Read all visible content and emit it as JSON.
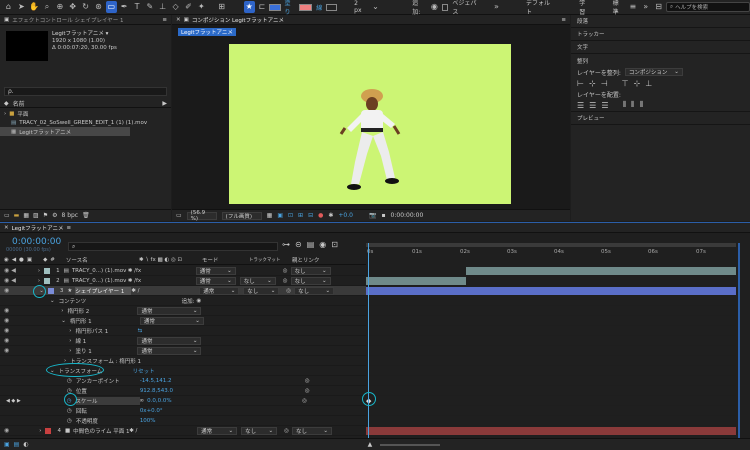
{
  "toolbar": {
    "fill_label": "塗り",
    "stroke_label": "線",
    "stroke_width": "2 px",
    "add_label": "追加:",
    "bezier_label": "ベジェパス",
    "workspaces": [
      "デフォルト",
      "学習",
      "標準"
    ],
    "search_placeholder": "ヘルプを検索",
    "fill_color": "#3a6fd8",
    "stroke_color": "#f08080"
  },
  "effect_controls": {
    "tab_label": "エフェクトコントロール シェイプレイヤー 1"
  },
  "project": {
    "comp_name": "Legitフラットアニメ ▾",
    "comp_size": "1920 x 1080 (1.00)",
    "comp_duration": "Δ 0:00:07:20, 30.00 fps",
    "search_icon_glyph": "ρ.",
    "column_name": "名前",
    "items": [
      {
        "name": "平面",
        "type": "folder"
      },
      {
        "name": "TRACY_02_SoSwell_GREEN_EDIT_1 (1) (1).mov",
        "type": "footage"
      },
      {
        "name": "Legitフラットアニメ",
        "type": "comp"
      }
    ],
    "bpc": "8 bpc"
  },
  "composition": {
    "tab_label": "コンポジション Legitフラットアニメ",
    "breadcrumb": "Legitフラットアニメ",
    "zoom": "(56.9 %)",
    "resolution": "(フル画質)",
    "exposure": "+0.0",
    "timecode": "0:00:00:00",
    "bg_color": "#ccf574"
  },
  "right_panel": {
    "items": [
      "段落",
      "トラッカー",
      "文字",
      "整列",
      "プレビュー"
    ],
    "align_to_label": "レイヤーを整列:",
    "align_to_value": "コンポジション",
    "distribute_label": "レイヤーを配置:"
  },
  "timeline": {
    "tab_label": "Legitフラットアニメ",
    "timecode": "0:00:00:00",
    "timecode_sub": "00000 (30.00 fps)",
    "col_source": "ソース名",
    "col_mode": "モード",
    "col_trkmat": "トラックマット",
    "col_parent": "親とリンク",
    "ruler": [
      "0s",
      "01s",
      "02s",
      "03s",
      "04s",
      "05s",
      "06s",
      "07s"
    ],
    "layers": [
      {
        "num": "1",
        "name": "TRACY_0...) (1).mov",
        "mode": "通常",
        "trkmat": "",
        "parent": "なし",
        "color": "#9fbfbf"
      },
      {
        "num": "2",
        "name": "TRACY_0...) (1).mov",
        "mode": "通常",
        "trkmat": "なし",
        "parent": "なし",
        "color": "#9fbfbf"
      },
      {
        "num": "3",
        "name": "シェイプレイヤー 1",
        "mode": "通常",
        "trkmat": "なし",
        "parent": "なし",
        "color": "#7a8cd8"
      },
      {
        "num": "4",
        "name": "中間色のライム 平面 1",
        "mode": "通常",
        "trkmat": "なし",
        "parent": "なし",
        "color": "#c84040"
      }
    ],
    "props": {
      "contents": "コンテンツ",
      "add": "追加:",
      "shape2": "楕円形 2",
      "shape1": "楕円形 1",
      "shape1_mode": "通常",
      "shape2_mode": "通常",
      "ellipse_path": "楕円形パス 1",
      "stroke1": "線 1",
      "stroke1_mode": "通常",
      "fill1": "塗り 1",
      "fill1_mode": "通常",
      "transform_ellipse": "トランスフォーム : 楕円形 1",
      "transform": "トランスフォーム",
      "reset": "リセット",
      "anchor": "アンカーポイント",
      "anchor_val": "-14.5,141.2",
      "position": "位置",
      "position_val": "912.8,543.0",
      "scale": "スケール",
      "scale_val": "0.0,0.0%",
      "rotation": "回転",
      "rotation_val": "0x+0.0°",
      "opacity": "不透明度",
      "opacity_val": "100%"
    }
  }
}
